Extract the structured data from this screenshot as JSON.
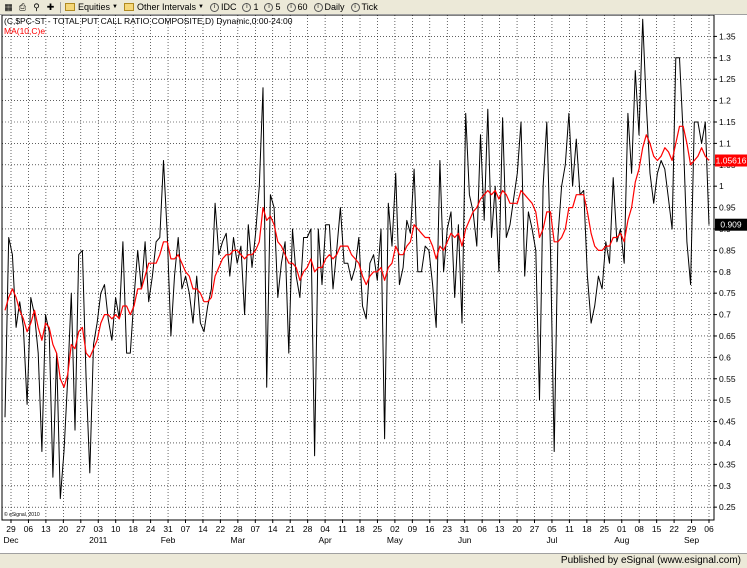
{
  "toolbar": {
    "items": [
      {
        "label": "Equities",
        "dropdown": true
      },
      {
        "label": "Other Intervals",
        "dropdown": true
      },
      {
        "label": "IDC",
        "icon": "circle-i-icon"
      },
      {
        "label": "1",
        "icon": "circle-i-icon"
      },
      {
        "label": "5",
        "icon": "circle-i-icon"
      },
      {
        "label": "60",
        "icon": "circle-i-icon"
      },
      {
        "label": "Daily",
        "icon": "circle-i-icon"
      },
      {
        "label": "Tick",
        "icon": "circle-i-icon"
      }
    ]
  },
  "chart_data": {
    "type": "line",
    "title": "(C,$PC-ST - TOTAL PUT CALL RATIO COMPOSITE,D) Dynamic,0:00-24:00",
    "subtitle": "MA(10,C)e",
    "watermark": "© eSignal, 2010",
    "grid": true,
    "ylim": [
      0.22,
      1.4
    ],
    "y_ticks": [
      "1.35",
      "1.3",
      "1.25",
      "1.2",
      "1.15",
      "1.1",
      "1.05",
      "1",
      "0.95",
      "0.9",
      "0.85",
      "0.8",
      "0.75",
      "0.7",
      "0.65",
      "0.6",
      "0.55",
      "0.5",
      "0.45",
      "0.4",
      "0.35",
      "0.3",
      "0.25"
    ],
    "x_ticks": [
      "29",
      "06",
      "13",
      "20",
      "27",
      "03",
      "10",
      "18",
      "24",
      "31",
      "07",
      "14",
      "22",
      "28",
      "07",
      "14",
      "21",
      "28",
      "04",
      "11",
      "18",
      "25",
      "02",
      "09",
      "16",
      "23",
      "31",
      "06",
      "13",
      "20",
      "27",
      "05",
      "11",
      "18",
      "25",
      "01",
      "08",
      "15",
      "22",
      "29",
      "06"
    ],
    "x_month_labels": [
      {
        "label": "Dec",
        "at_tick": 0
      },
      {
        "label": "2011",
        "at_tick": 5
      },
      {
        "label": "Feb",
        "at_tick": 9
      },
      {
        "label": "Mar",
        "at_tick": 13
      },
      {
        "label": "Apr",
        "at_tick": 18
      },
      {
        "label": "May",
        "at_tick": 22
      },
      {
        "label": "Jun",
        "at_tick": 26
      },
      {
        "label": "Jul",
        "at_tick": 31
      },
      {
        "label": "Aug",
        "at_tick": 35
      },
      {
        "label": "Sep",
        "at_tick": 39
      }
    ],
    "colors": {
      "price": "#000000",
      "ma": "#ff0000"
    },
    "series": [
      {
        "name": "(C,$PC-ST - TOTAL PUT CALL RATIO COMPOSITE,D)",
        "color": "#000000",
        "values": [
          0.46,
          0.88,
          0.84,
          0.67,
          0.73,
          0.67,
          0.49,
          0.74,
          0.7,
          0.61,
          0.38,
          0.7,
          0.66,
          0.32,
          0.61,
          0.27,
          0.38,
          0.55,
          0.75,
          0.43,
          0.84,
          0.85,
          0.55,
          0.33,
          0.63,
          0.68,
          0.75,
          0.77,
          0.69,
          0.64,
          0.74,
          0.69,
          0.87,
          0.61,
          0.61,
          0.74,
          0.85,
          0.76,
          0.87,
          0.73,
          0.79,
          0.87,
          0.88,
          1.06,
          0.89,
          0.65,
          0.79,
          0.88,
          0.76,
          0.79,
          0.75,
          0.68,
          0.79,
          0.68,
          0.66,
          0.72,
          0.76,
          0.96,
          0.84,
          0.87,
          0.89,
          0.79,
          0.88,
          0.82,
          0.86,
          0.7,
          0.91,
          0.81,
          0.89,
          1.0,
          1.23,
          0.53,
          0.98,
          0.95,
          0.74,
          0.82,
          0.87,
          0.61,
          0.9,
          0.79,
          0.74,
          0.88,
          0.88,
          0.9,
          0.37,
          0.9,
          0.77,
          0.91,
          0.91,
          0.76,
          0.85,
          0.95,
          0.82,
          0.82,
          0.78,
          0.81,
          0.88,
          0.72,
          0.69,
          0.82,
          0.84,
          0.78,
          0.9,
          0.41,
          0.96,
          0.86,
          1.03,
          0.77,
          0.81,
          0.92,
          0.89,
          1.04,
          0.8,
          0.8,
          0.86,
          0.85,
          0.77,
          0.67,
          1.06,
          0.8,
          0.9,
          0.94,
          0.74,
          0.91,
          0.68,
          1.17,
          0.98,
          0.94,
          0.86,
          1.12,
          0.92,
          1.18,
          0.88,
          1.0,
          0.8,
          1.16,
          0.88,
          0.91,
          0.97,
          1.03,
          1.15,
          0.79,
          0.94,
          0.9,
          0.85,
          0.5,
          1.0,
          1.15,
          0.85,
          0.38,
          0.88,
          1.0,
          1.05,
          1.17,
          1.0,
          1.11,
          0.98,
          0.99,
          0.79,
          0.68,
          0.72,
          0.79,
          0.76,
          0.87,
          0.82,
          1.02,
          0.87,
          0.9,
          0.82,
          1.17,
          1.03,
          1.27,
          1.12,
          1.39,
          1.19,
          1.03,
          0.96,
          1.03,
          1.06,
          1.04,
          0.97,
          0.9,
          1.3,
          1.3,
          1.12,
          0.87,
          0.77,
          1.15,
          1.15,
          1.1,
          1.15,
          0.91
        ]
      },
      {
        "name": "MA(10,C)e",
        "color": "#ff0000",
        "values": [
          0.71,
          0.74,
          0.76,
          0.74,
          0.71,
          0.69,
          0.66,
          0.68,
          0.71,
          0.67,
          0.64,
          0.68,
          0.67,
          0.63,
          0.61,
          0.55,
          0.53,
          0.56,
          0.63,
          0.62,
          0.66,
          0.67,
          0.61,
          0.6,
          0.62,
          0.64,
          0.68,
          0.7,
          0.7,
          0.69,
          0.7,
          0.69,
          0.72,
          0.72,
          0.7,
          0.72,
          0.76,
          0.76,
          0.79,
          0.82,
          0.82,
          0.82,
          0.84,
          0.87,
          0.87,
          0.83,
          0.83,
          0.84,
          0.82,
          0.8,
          0.79,
          0.76,
          0.76,
          0.75,
          0.73,
          0.73,
          0.74,
          0.79,
          0.81,
          0.83,
          0.84,
          0.84,
          0.85,
          0.85,
          0.84,
          0.83,
          0.84,
          0.84,
          0.85,
          0.87,
          0.95,
          0.92,
          0.93,
          0.91,
          0.87,
          0.86,
          0.84,
          0.82,
          0.82,
          0.81,
          0.78,
          0.8,
          0.81,
          0.83,
          0.8,
          0.81,
          0.81,
          0.83,
          0.84,
          0.83,
          0.84,
          0.86,
          0.86,
          0.86,
          0.84,
          0.83,
          0.82,
          0.79,
          0.77,
          0.79,
          0.8,
          0.8,
          0.81,
          0.78,
          0.81,
          0.82,
          0.86,
          0.84,
          0.84,
          0.86,
          0.87,
          0.91,
          0.9,
          0.89,
          0.88,
          0.88,
          0.86,
          0.83,
          0.86,
          0.85,
          0.87,
          0.89,
          0.88,
          0.89,
          0.86,
          0.9,
          0.92,
          0.94,
          0.95,
          0.97,
          0.98,
          0.99,
          0.98,
          0.99,
          0.97,
          0.99,
          0.98,
          0.96,
          0.96,
          0.96,
          0.99,
          0.98,
          0.97,
          0.96,
          0.94,
          0.88,
          0.9,
          0.94,
          0.94,
          0.87,
          0.87,
          0.88,
          0.9,
          0.95,
          0.95,
          0.98,
          0.98,
          0.98,
          0.94,
          0.89,
          0.86,
          0.85,
          0.85,
          0.86,
          0.86,
          0.88,
          0.88,
          0.89,
          0.87,
          0.92,
          0.95,
          1.01,
          1.04,
          1.09,
          1.12,
          1.1,
          1.07,
          1.06,
          1.07,
          1.09,
          1.08,
          1.06,
          1.1,
          1.14,
          1.14,
          1.1,
          1.05,
          1.06,
          1.07,
          1.09,
          1.07,
          1.06
        ]
      }
    ],
    "last_value_labels": [
      {
        "series": "MA(10,C)e",
        "text": "1.05616",
        "bg": "#ff0000",
        "color": "#ffffff"
      },
      {
        "series": "(C,$PC-ST - TOTAL PUT CALL RATIO COMPOSITE,D)",
        "text": "0.909",
        "bg": "#000000",
        "color": "#ffffff"
      }
    ]
  },
  "footer": {
    "publisher": "Published by eSignal (www.esignal.com)"
  }
}
